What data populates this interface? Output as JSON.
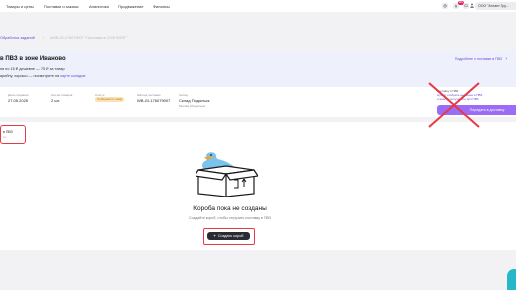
{
  "nav": {
    "items": [
      "Товары и цены",
      "Поставки и заказы",
      "Аналитика",
      "Продвижение",
      "Финансы"
    ]
  },
  "header": {
    "org_name": "ООО \"Атлант Гру...",
    "notification_count": "99+"
  },
  "breadcrumb": {
    "link": "Обработка заданий",
    "separator": "/",
    "current": "#WB-GI-176079007 \"Поставка в СОФ ВЭЗГ\""
  },
  "banner": {
    "title": "в ПВЗ в зоне Иваново",
    "line1": "ни по 15 ₽ дешевле — 75 ₽ за товар",
    "line2_prefix": "арибну, хорошо — посмотрите на",
    "line2_link": "карте складов",
    "more_link": "Подробнее о поставке в ПВЗ",
    "more_chevron": "›"
  },
  "info": {
    "created_label": "Дата создания",
    "created_value": "27.05.2025",
    "qty_label": "Кол-во товаров",
    "qty_value": "2 шт.",
    "status_label": "Статус",
    "status_value": "Собирается товар",
    "id_label": "ШК-код поставки",
    "id_value": "WB-GI-176079007",
    "warehouse_label": "Склад",
    "warehouse_value": "Склад Подольск",
    "warehouse_sub": "Москва (Подольск)"
  },
  "right_panel": {
    "text1": "поставку в ПВЗ",
    "text2": "Нужно отобрать не менее в ПВЗ",
    "text3": "и внести получателя для ПВЗ",
    "button_label": "Передать в доставку"
  },
  "left_chip": {
    "title": "в ПВЗ",
    "sub": "от ..."
  },
  "empty_state": {
    "title": "Короба пока не созданы",
    "subtitle": "Создайте короб, чтобы отгрузить поставку в ПВЗ",
    "button_label": "Создать короб",
    "button_plus": "+"
  },
  "colors": {
    "accent": "#6b48d6",
    "annotation_red": "#e63946",
    "button_purple": "#9b6cf5",
    "dark_button": "#2b2b33",
    "illustration_blue": "#79c3ec"
  }
}
